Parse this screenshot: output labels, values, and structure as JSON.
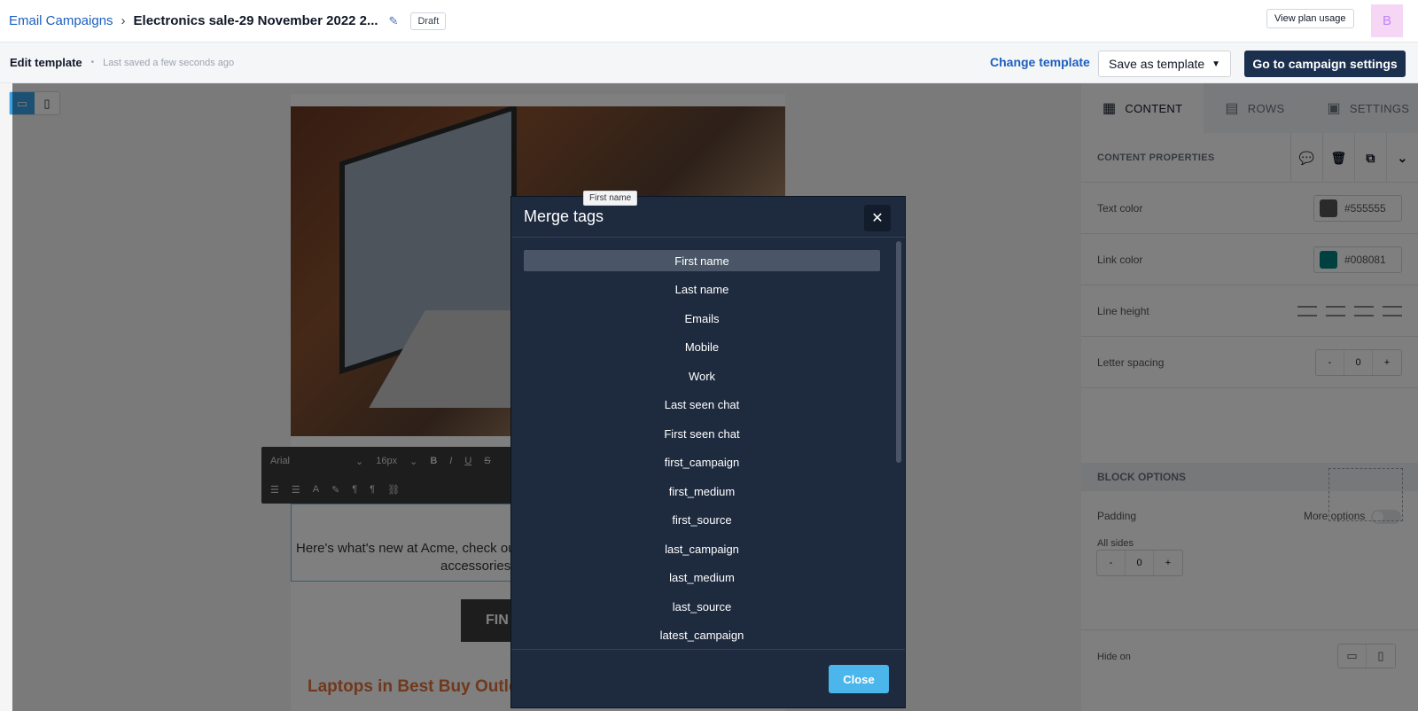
{
  "header": {
    "breadcrumb_root": "Email Campaigns",
    "campaign_title": "Electronics sale-29 November 2022 2...",
    "status": "Draft",
    "plan_usage": "View plan usage",
    "avatar_initial": "B"
  },
  "subbar": {
    "title": "Edit template",
    "saved_status": "Last saved a few seconds ago",
    "change_template": "Change template",
    "save_as_template": "Save as template",
    "go_to_settings": "Go to campaign settings"
  },
  "editor": {
    "font_family": "Arial",
    "font_size": "16px",
    "body_line1": "Here's what's new at Acme, check ou",
    "body_line2": "accessories",
    "cta_label": "FIN",
    "product_heading": "Laptops in Best Buy Outle"
  },
  "right_panel": {
    "tabs": [
      "CONTENT",
      "ROWS",
      "SETTINGS"
    ],
    "content_properties": "CONTENT PROPERTIES",
    "text_color_label": "Text color",
    "text_color_value": "#555555",
    "link_color_label": "Link color",
    "link_color_value": "#008081",
    "line_height_label": "Line height",
    "letter_spacing_label": "Letter spacing",
    "letter_spacing_value": "0",
    "block_options": "BLOCK OPTIONS",
    "padding_label": "Padding",
    "more_options": "More options",
    "all_sides_label": "All sides",
    "padding_value": "0",
    "hide_on_label": "Hide on",
    "stepper_minus": "-",
    "stepper_plus": "+"
  },
  "modal": {
    "title": "Merge tags",
    "tooltip": "First name",
    "tags": [
      "First name",
      "Last name",
      "Emails",
      "Mobile",
      "Work",
      "Last seen chat",
      "First seen chat",
      "first_campaign",
      "first_medium",
      "first_source",
      "last_campaign",
      "last_medium",
      "last_source",
      "latest_campaign"
    ],
    "selected_index": 0,
    "close_button": "Close"
  },
  "colors": {
    "primary_link": "#1d5fbf",
    "primary_button": "#1b2f4e",
    "modal_bg": "#1e2b3f",
    "close_button": "#4ab6ec",
    "text_color_swatch": "#555555",
    "link_color_swatch": "#008081",
    "heading_orange": "#e0703a"
  }
}
